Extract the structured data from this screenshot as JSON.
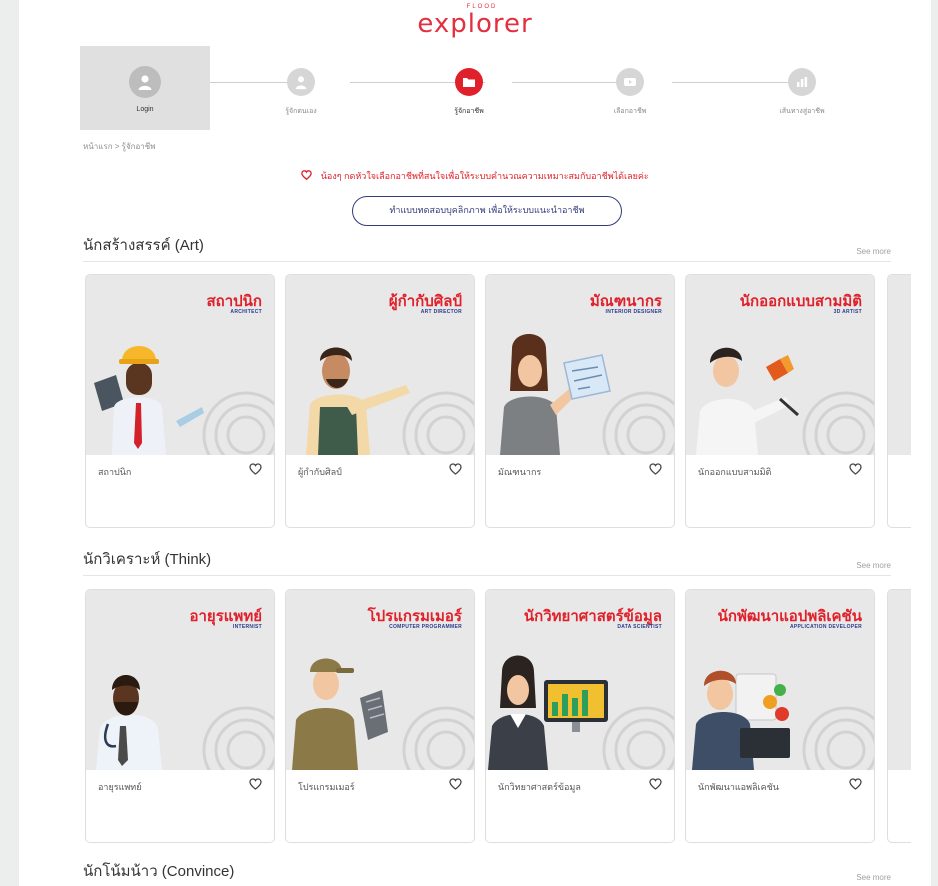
{
  "header": {
    "logo_super": "FLOOD",
    "logo_text": "explorer"
  },
  "stepper": [
    {
      "label": "Login",
      "icon": "user-icon",
      "state": "current"
    },
    {
      "label": "รู้จักตนเอง",
      "icon": "user-icon",
      "state": "todo"
    },
    {
      "label": "รู้จักอาชีพ",
      "icon": "folder-icon",
      "state": "active"
    },
    {
      "label": "เลือกอาชีพ",
      "icon": "video-icon",
      "state": "todo"
    },
    {
      "label": "เส้นทางสู่อาชีพ",
      "icon": "chart-icon",
      "state": "todo"
    }
  ],
  "breadcrumb": "หน้าแรก > รู้จักอาชีพ",
  "favorite_note": "น้องๆ กดหัวใจเลือกอาชีพที่สนใจเพื่อให้ระบบคำนวณความเหมาะสมกับอาชีพได้เลยค่ะ",
  "personality_test_button": "ทำแบบทดสอบบุคลิกภาพ เพื่อให้ระบบแนะนำอาชีพ",
  "sections": [
    {
      "title": "นักสร้างสรรค์ (Art)",
      "see_more": "See more",
      "cards": [
        {
          "title_th": "สถาปนิก",
          "title_en": "ARCHITECT",
          "name": "สถาปนิก"
        },
        {
          "title_th": "ผู้กำกับศิลป์",
          "title_en": "ART DIRECTOR",
          "name": "ผู้กำกับศิลป์"
        },
        {
          "title_th": "มัณฑนากร",
          "title_en": "INTERIOR DESIGNER",
          "name": "มัณฑนากร"
        },
        {
          "title_th": "นักออกแบบสามมิติ",
          "title_en": "3D ARTIST",
          "name": "นักออกแบบสามมิติ"
        }
      ]
    },
    {
      "title": "นักวิเคราะห์ (Think)",
      "see_more": "See more",
      "cards": [
        {
          "title_th": "อายุรแพทย์",
          "title_en": "INTERNIST",
          "name": "อายุรแพทย์"
        },
        {
          "title_th": "โปรแกรมเมอร์",
          "title_en": "COMPUTER PROGRAMMER",
          "name": "โปรแกรมเมอร์"
        },
        {
          "title_th": "นักวิทยาศาสตร์ข้อมูล",
          "title_en": "DATA SCIENTIST",
          "name": "นักวิทยาศาสตร์ข้อมูล"
        },
        {
          "title_th": "นักพัฒนาแอปพลิเคชัน",
          "title_en": "APPLICATION DEVELOPER",
          "name": "นักพัฒนาแอพลิเคชัน"
        }
      ]
    },
    {
      "title": "นักโน้มน้าว (Convince)",
      "see_more": "See more"
    }
  ],
  "colors": {
    "brand_red": "#e0212b",
    "navy": "#2a3a8c",
    "card_bg": "#e8e8e8"
  }
}
